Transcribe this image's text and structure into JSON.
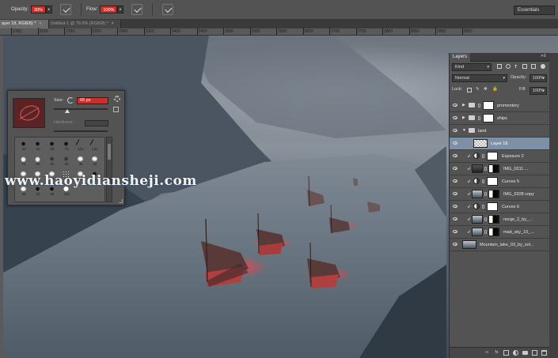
{
  "options_bar": {
    "opacity_label": "Opacity:",
    "opacity_value": "30%",
    "flow_label": "Flow:",
    "flow_value": "100%",
    "workspace": "Essentials"
  },
  "tabs": [
    {
      "label": "ayer 18, RGB/8) *",
      "active": true
    },
    {
      "label": "Untitled-1 @ 76.6% (RGB/8) *",
      "active": false
    }
  ],
  "ruler": {
    "ticks": [
      "2100",
      "2150",
      "2200",
      "2250",
      "2300",
      "2350",
      "2400",
      "2450",
      "2500",
      "2550",
      "2600",
      "2650",
      "2700",
      "2750",
      "2800",
      "2850",
      "2900",
      "2950"
    ]
  },
  "brush_panel": {
    "size_label": "Size:",
    "size_value": "65 px",
    "hardness_label": "Hardness:",
    "presets": [
      "30",
      "42",
      "55",
      "70",
      "112",
      "134",
      "74",
      "95",
      "95",
      "90",
      "36",
      "36",
      "33",
      "63",
      "66",
      "39",
      "63",
      "11",
      "48",
      "32",
      "55",
      "100",
      "",
      ""
    ]
  },
  "watermark": "www.haoyidiansheji.com",
  "layers_panel": {
    "title": "Layers",
    "kind_filter": "Kind",
    "blend_mode": "Normal",
    "opacity_label": "Opacity:",
    "opacity_value": "100%",
    "lock_label": "Lock:",
    "fill_label": "Fill:",
    "fill_value": "100%",
    "layers": [
      {
        "name": "promontory",
        "type": "group",
        "indent": 0,
        "active": false
      },
      {
        "name": "ships",
        "type": "group",
        "indent": 0,
        "active": false
      },
      {
        "name": "land",
        "type": "group-open",
        "indent": 0,
        "active": false
      },
      {
        "name": "Layer 18",
        "type": "pixel",
        "indent": 1,
        "active": true
      },
      {
        "name": "Exposure 2",
        "type": "adjust",
        "indent": 1,
        "active": false
      },
      {
        "name": "IMG_0311 ...",
        "type": "photo-mask",
        "indent": 1,
        "active": false
      },
      {
        "name": "Curves 5",
        "type": "adjust",
        "indent": 1,
        "active": false
      },
      {
        "name": "IMG_0328 copy",
        "type": "photo-mask",
        "indent": 1,
        "active": false
      },
      {
        "name": "Curves 6",
        "type": "adjust",
        "indent": 1,
        "active": false
      },
      {
        "name": "norge_2_by_...",
        "type": "photo-mask",
        "indent": 1,
        "active": false
      },
      {
        "name": "mad_sky_10_...",
        "type": "photo-mask",
        "indent": 1,
        "active": false
      },
      {
        "name": "Mountain_lake_03_by_sol...",
        "type": "photo",
        "indent": 0,
        "active": false
      }
    ],
    "footer_icons": [
      "link-icon",
      "fx-icon",
      "mask-icon",
      "adjustment-icon",
      "folder-icon",
      "new-layer-icon",
      "trash-icon"
    ],
    "footer_labels": [
      "∞",
      "fx",
      "",
      "",
      "",
      "",
      ""
    ]
  },
  "colors": {
    "accent_red": "#c9302c",
    "active_layer": "#7d90a6",
    "panel": "#535353"
  }
}
